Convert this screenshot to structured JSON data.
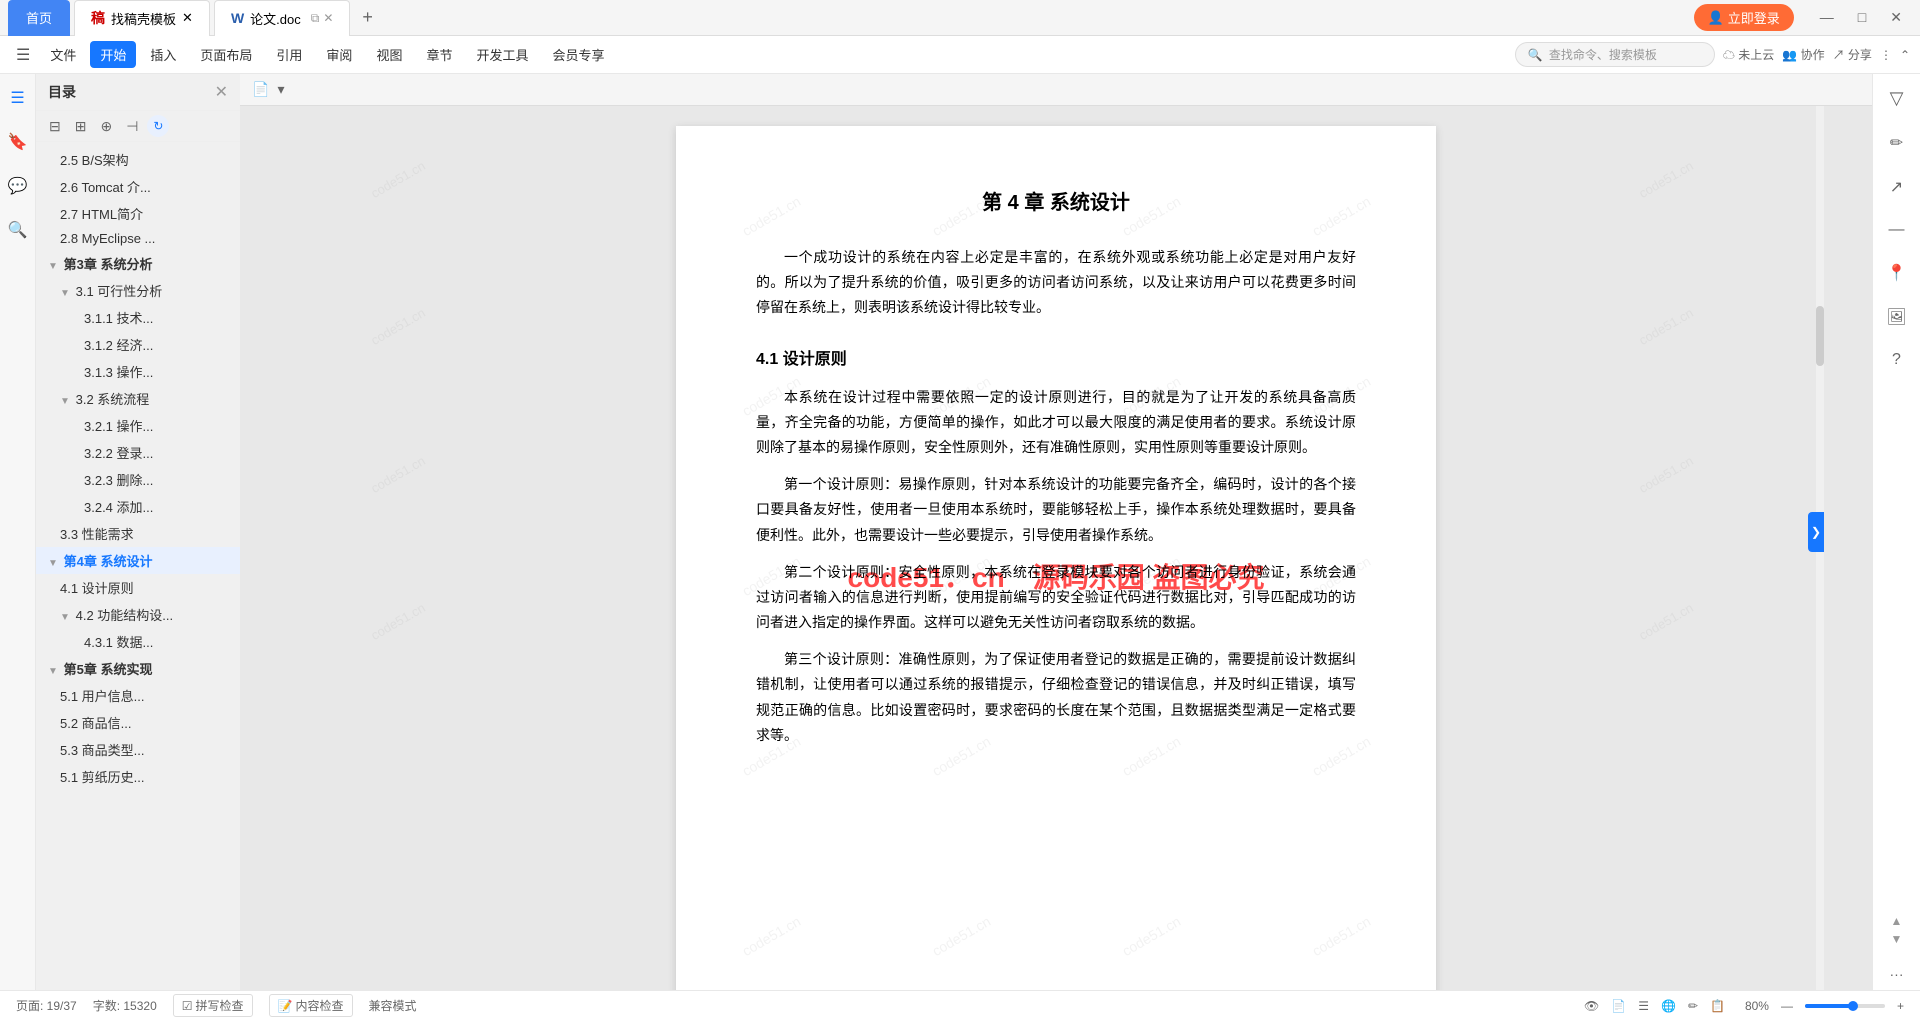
{
  "titleBar": {
    "tabHome": "首页",
    "tabWps": "找稿壳模板",
    "tabDoc": "论文.doc",
    "addTab": "+",
    "btnLogin": "立即登录",
    "minBtn": "—",
    "maxBtn": "□",
    "closeBtn": "✕"
  },
  "menuBar": {
    "items": [
      "文件",
      "开始",
      "插入",
      "页面布局",
      "引用",
      "审阅",
      "视图",
      "章节",
      "开发工具",
      "会员专享"
    ],
    "activeItem": "开始",
    "search": "查找命令、搜索模板",
    "notSynced": "未上云",
    "collaborate": "协作",
    "share": "分享"
  },
  "toc": {
    "title": "目录",
    "items": [
      {
        "level": 2,
        "text": "2.5 B/S架构",
        "indent": 2
      },
      {
        "level": 2,
        "text": "2.6 Tomcat 介...",
        "indent": 2,
        "expanded": true
      },
      {
        "level": 2,
        "text": "2.7 HTML简介",
        "indent": 2
      },
      {
        "level": 2,
        "text": "2.8 MyEclipse ...",
        "indent": 2
      },
      {
        "level": 1,
        "text": "第3章 系统分析",
        "indent": 1
      },
      {
        "level": 2,
        "text": "3.1 可行性分析",
        "indent": 2
      },
      {
        "level": 3,
        "text": "3.1.1 技术...",
        "indent": 3
      },
      {
        "level": 3,
        "text": "3.1.2 经济...",
        "indent": 3
      },
      {
        "level": 3,
        "text": "3.1.3 操作...",
        "indent": 3
      },
      {
        "level": 2,
        "text": "3.2 系统流程",
        "indent": 2
      },
      {
        "level": 3,
        "text": "3.2.1 操作...",
        "indent": 3
      },
      {
        "level": 3,
        "text": "3.2.2 登录...",
        "indent": 3
      },
      {
        "level": 3,
        "text": "3.2.3 删除...",
        "indent": 3
      },
      {
        "level": 3,
        "text": "3.2.4 添加...",
        "indent": 3
      },
      {
        "level": 2,
        "text": "3.3 性能需求",
        "indent": 2
      },
      {
        "level": 1,
        "text": "第4章 系统设计",
        "indent": 1,
        "active": true
      },
      {
        "level": 2,
        "text": "4.1 设计原则",
        "indent": 2
      },
      {
        "level": 2,
        "text": "4.2 功能结构设...",
        "indent": 2
      },
      {
        "level": 3,
        "text": "4.3.1 数据...",
        "indent": 3
      },
      {
        "level": 1,
        "text": "第5章 系统实现",
        "indent": 1
      },
      {
        "level": 2,
        "text": "5.1 用户信息...",
        "indent": 2
      },
      {
        "level": 2,
        "text": "5.2 商品信...",
        "indent": 2
      },
      {
        "level": 2,
        "text": "5.3 商品类型...",
        "indent": 2
      },
      {
        "level": 2,
        "text": "5.1 剪纸历史...",
        "indent": 2
      }
    ]
  },
  "document": {
    "chapterTitle": "第 4 章  系统设计",
    "intro": "一个成功设计的系统在内容上必定是丰富的，在系统外观或系统功能上必定是对用户友好的。所以为了提升系统的价值，吸引更多的访问者访问系统，以及让来访用户可以花费更多时间停留在系统上，则表明该系统设计得比较专业。",
    "section41Title": "4.1  设计原则",
    "section41Para1": "本系统在设计过程中需要依照一定的设计原则进行，目的就是为了让开发的系统具备高质量，齐全完备的功能，方便简单的操作，如此才可以最大限度的满足使用者的要求。系统设计原则除了基本的易操作原则，安全性原则外，还有准确性原则，实用性原则等重要设计原则。",
    "section41Para2": "第一个设计原则：易操作原则，针对本系统设计的功能要完备齐全，编码时，设计的各个接口要具备友好性，使用者一旦使用本系统时，要能够轻松上手，操作本系统处理数据时，要具备便利性。此外，也需要设计一些必要提示，引导使用者操作系统。",
    "section41Para3": "第二个设计原则：安全性原则，本系统在登录模块要对各个访问者进行身份验证，系统会通过访问者输入的信息进行判断，使用提前编写的安全验证代码进行数据比对，引导匹配成功的访问者进入指定的操作界面。这样可以避免无关性访问者窃取系统的数据。",
    "section41Para4": "第三个设计原则：准确性原则，为了保证使用者登记的数据是正确的，需要提前设计数据纠错机制，让使用者可以通过系统的报错提示，仔细检查登记的错误信息，并及时纠正错误，填写规范正确的信息。比如设置密码时，要求密码的长度在某个范围，且数据据类型满足一定格式要求等。",
    "watermarkText": "code51.cn",
    "watermarkRed": "code51．cn　源码乐园 盗图必究"
  },
  "statusBar": {
    "page": "页面: 19/37",
    "wordCount": "字数: 15320",
    "spellCheck": "拼写检查",
    "contentCheck": "内容检查",
    "compatMode": "兼容模式",
    "readMode": "👁",
    "printMode": "📄",
    "webMode": "≡",
    "mobileMode": "📱",
    "globalMode": "🌐",
    "editMode": "✏",
    "pageMode": "📋",
    "zoom": "80%",
    "zoomOut": "—",
    "zoomIn": "+"
  },
  "rightPanel": {
    "icons": [
      "✏",
      "↗",
      "—",
      "⊕",
      "📷",
      "🔍"
    ]
  },
  "colors": {
    "accent": "#1677ff",
    "tabHome": "#4285f4",
    "loginBtn": "#ff6b35",
    "watermarkRed": "#cc0000"
  }
}
